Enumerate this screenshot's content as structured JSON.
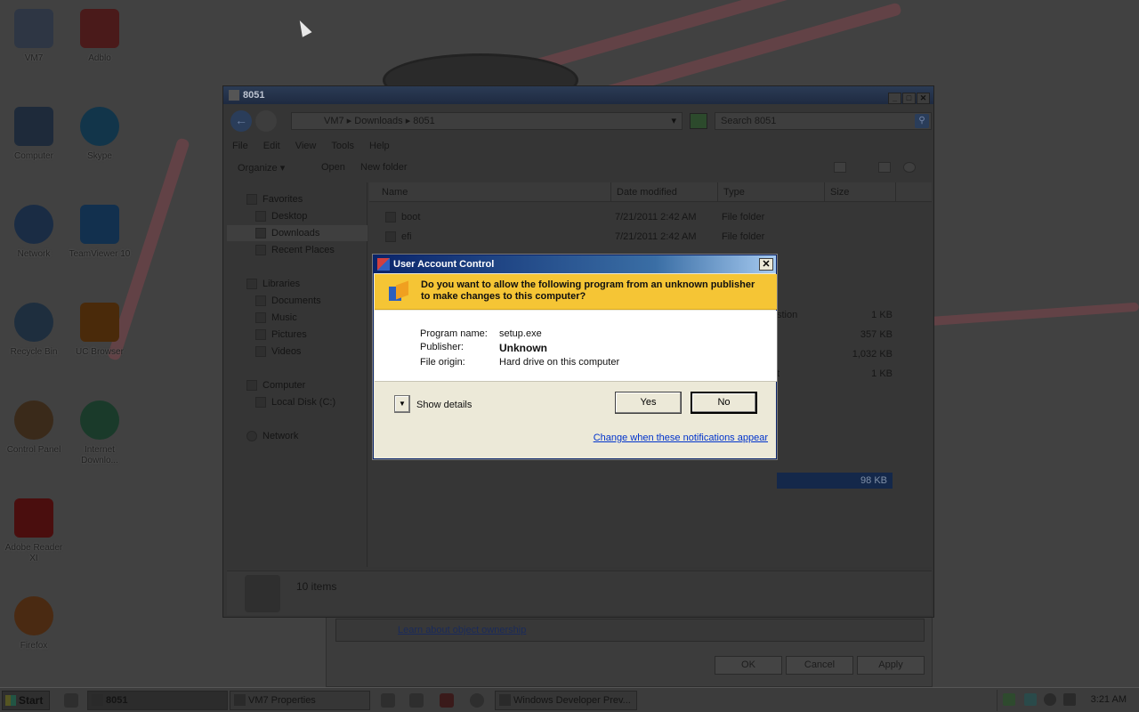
{
  "desktop": {
    "icons": [
      {
        "label": "VM7"
      },
      {
        "label": "Adblo"
      },
      {
        "label": "Computer"
      },
      {
        "label": "Skype"
      },
      {
        "label": "Network"
      },
      {
        "label": "TeamViewer 10"
      },
      {
        "label": "Recycle Bin"
      },
      {
        "label": "UC Browser"
      },
      {
        "label": "Control Panel"
      },
      {
        "label": "Internet Downlo..."
      },
      {
        "label": "Adobe Reader XI"
      },
      {
        "label": "Firefox"
      }
    ]
  },
  "explorer": {
    "title": "8051",
    "address": {
      "crumbs": [
        "VM7",
        "Downloads",
        "8051"
      ],
      "text": "VM7 ▸ Downloads ▸ 8051"
    },
    "search_placeholder": "Search 8051",
    "menu": [
      "File",
      "Edit",
      "View",
      "Tools",
      "Help"
    ],
    "toolbar": {
      "organize": "Organize ▾",
      "open": "Open",
      "new_folder": "New folder"
    },
    "nav": {
      "favorites": "Favorites",
      "desktop": "Desktop",
      "downloads": "Downloads",
      "recent_places": "Recent Places",
      "libraries": "Libraries",
      "documents": "Documents",
      "music": "Music",
      "pictures": "Pictures",
      "videos": "Videos",
      "computer": "Computer",
      "local_disk": "Local Disk (C:)",
      "network": "Network"
    },
    "columns": {
      "name": "Name",
      "date": "Date modified",
      "type": "Type",
      "size": "Size"
    },
    "files": [
      {
        "name": "boot",
        "date": "7/21/2011 2:42 AM",
        "type": "File folder",
        "size": ""
      },
      {
        "name": "efi",
        "date": "7/21/2011 2:42 AM",
        "type": "File folder",
        "size": ""
      }
    ],
    "partial_rows": [
      {
        "type_fragment": "stion",
        "size": "1 KB"
      },
      {
        "type_fragment": "",
        "size": "357 KB"
      },
      {
        "type_fragment": "",
        "size": "1,032 KB"
      },
      {
        "type_fragment": "t",
        "size": "1 KB"
      },
      {
        "type_fragment": "",
        "size": "98 KB"
      }
    ],
    "status": "10 items"
  },
  "properties_window": {
    "link": "Learn about object ownership",
    "ok": "OK",
    "cancel": "Cancel",
    "apply": "Apply"
  },
  "uac": {
    "title": "User Account Control",
    "question": "Do you want to allow the following program from an unknown publisher to make changes to this computer?",
    "program_name_label": "Program name:",
    "program_name": "setup.exe",
    "publisher_label": "Publisher:",
    "publisher": "Unknown",
    "file_origin_label": "File origin:",
    "file_origin": "Hard drive on this computer",
    "show_details": "Show details",
    "yes": "Yes",
    "no": "No",
    "change_link": "Change when these notifications appear"
  },
  "taskbar": {
    "start": "Start",
    "tasks": [
      {
        "label": "8051",
        "active": true
      },
      {
        "label": "VM7 Properties",
        "active": false
      },
      {
        "label": "Windows Developer Prev...",
        "active": false
      }
    ],
    "clock": "3:21 AM"
  },
  "colors": {
    "uac_banner": "#f5c535",
    "uac_title": "#0a246a",
    "link": "#0033cc",
    "selection": "#14284a"
  }
}
